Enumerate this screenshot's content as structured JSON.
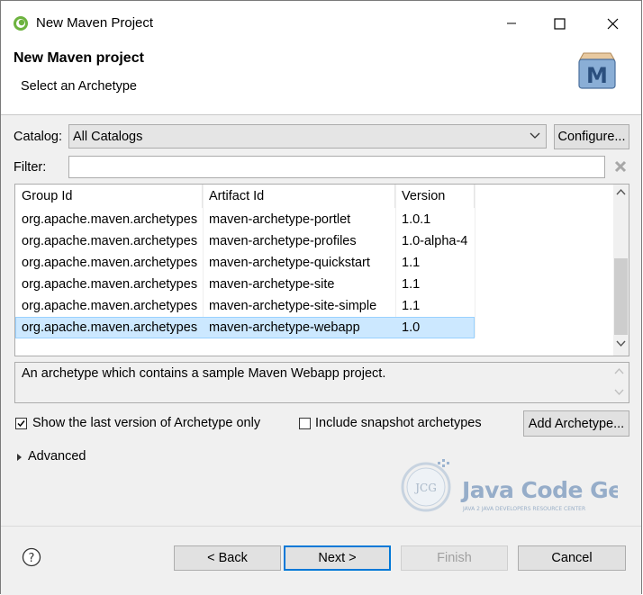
{
  "window": {
    "title": "New Maven Project"
  },
  "header": {
    "title": "New Maven project",
    "subtitle": "Select an Archetype",
    "logo_icon": "maven-m-icon"
  },
  "catalog": {
    "label": "Catalog:",
    "selected": "All Catalogs",
    "configure_label": "Configure..."
  },
  "filter": {
    "label": "Filter:",
    "value": ""
  },
  "table": {
    "columns": [
      "Group Id",
      "Artifact Id",
      "Version"
    ],
    "rows": [
      {
        "group": "org.apache.maven.archetypes",
        "artifact": "maven-archetype-portlet",
        "version": "1.0.1",
        "selected": false
      },
      {
        "group": "org.apache.maven.archetypes",
        "artifact": "maven-archetype-profiles",
        "version": "1.0-alpha-4",
        "selected": false
      },
      {
        "group": "org.apache.maven.archetypes",
        "artifact": "maven-archetype-quickstart",
        "version": "1.1",
        "selected": false
      },
      {
        "group": "org.apache.maven.archetypes",
        "artifact": "maven-archetype-site",
        "version": "1.1",
        "selected": false
      },
      {
        "group": "org.apache.maven.archetypes",
        "artifact": "maven-archetype-site-simple",
        "version": "1.1",
        "selected": false
      },
      {
        "group": "org.apache.maven.archetypes",
        "artifact": "maven-archetype-webapp",
        "version": "1.0",
        "selected": true
      }
    ]
  },
  "description": "An archetype which contains a sample Maven Webapp project.",
  "options": {
    "show_last_version": {
      "label": "Show the last version of Archetype only",
      "checked": true
    },
    "include_snapshot": {
      "label": "Include snapshot archetypes",
      "checked": false
    },
    "add_archetype_label": "Add Archetype..."
  },
  "advanced": {
    "label": "Advanced"
  },
  "watermark": {
    "title": "Java Code Geeks",
    "tagline": "JAVA 2 JAVA DEVELOPERS RESOURCE CENTER",
    "badge": "JCG"
  },
  "footer": {
    "back": "< Back",
    "next": "Next >",
    "finish": "Finish",
    "cancel": "Cancel"
  },
  "colors": {
    "selection": "#cce8ff",
    "primary_border": "#0078d7",
    "brand_blue": "#5b7ea6"
  }
}
